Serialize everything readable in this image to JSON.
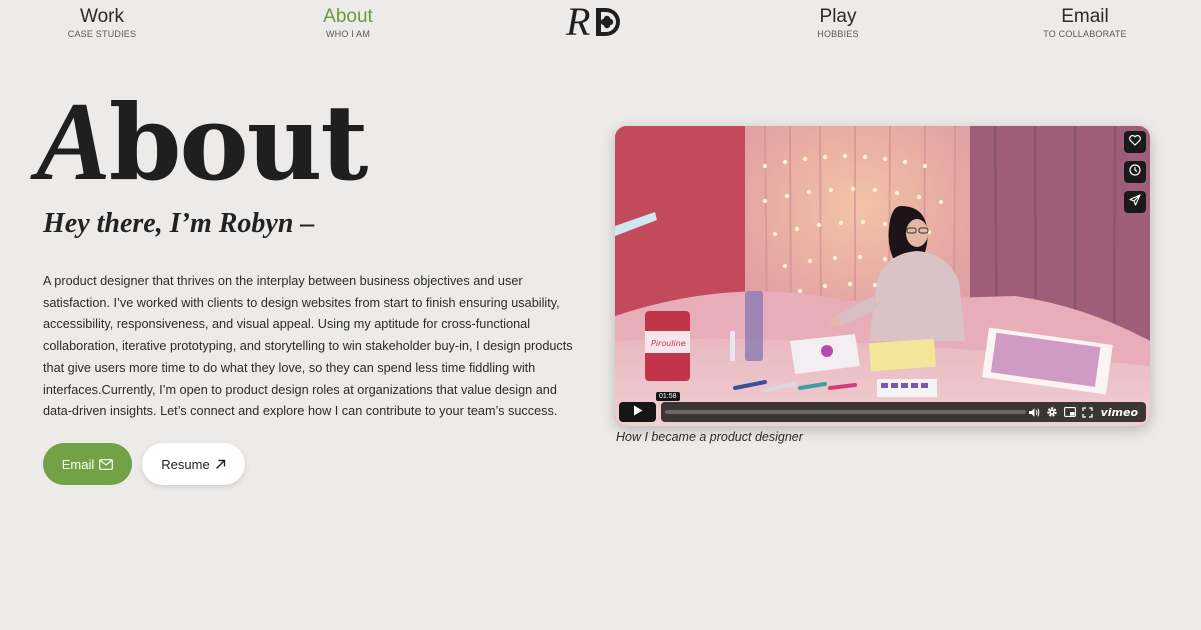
{
  "nav": {
    "work": {
      "title": "Work",
      "sub": "CASE STUDIES"
    },
    "about": {
      "title": "About",
      "sub": "WHO I AM"
    },
    "play": {
      "title": "Play",
      "sub": "HOBBIES"
    },
    "email": {
      "title": "Email",
      "sub": "TO COLLABORATE"
    },
    "logo_text": "RD"
  },
  "hero": {
    "title_cap": "A",
    "title_rest": "bout",
    "greeting": "Hey there, I’m Robyn –",
    "bio": "A product designer that thrives on the interplay between business objectives and user satisfaction. I’ve worked with clients to design websites from start to finish ensuring usability, accessibility, responsiveness, and visual appeal. Using my aptitude for cross-functional collaboration, iterative prototyping, and storytelling to win stakeholder buy-in, I design products that give users more time to do what they love, so they can spend less time fiddling with interfaces.Currently, I’m open to product design roles at organizations that value design and data-driven insights. Let’s connect and explore how I can contribute to your team’s success."
  },
  "buttons": {
    "email_label": "Email",
    "resume_label": "Resume"
  },
  "video": {
    "duration": "01:58",
    "brand": "vimeo",
    "caption": "How I became a product designer",
    "side_icons": [
      "heart-icon",
      "clock-icon",
      "send-icon"
    ],
    "control_icons": [
      "play-icon",
      "volume-icon",
      "settings-icon",
      "pip-icon",
      "fullscreen-icon"
    ]
  },
  "colors": {
    "background": "#edebe9",
    "accent": "#72a146",
    "active_nav": "#6a9a3a"
  }
}
